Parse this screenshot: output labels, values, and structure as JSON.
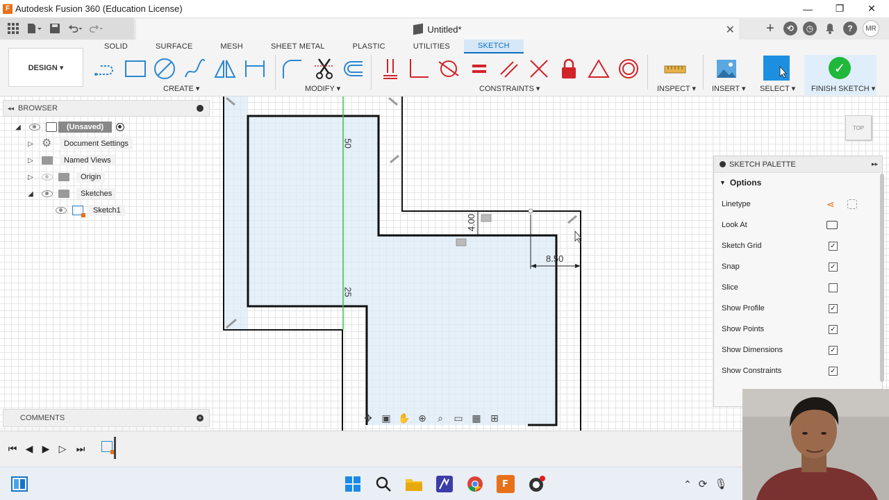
{
  "window": {
    "title": "Autodesk Fusion 360 (Education License)",
    "minimize": "—",
    "maximize": "❐",
    "close": "✕"
  },
  "document": {
    "tab_name": "Untitled*",
    "close": "✕",
    "new_tab": "+"
  },
  "user": {
    "initials": "MR"
  },
  "workspace": {
    "label": "DESIGN ▾"
  },
  "ribbon": {
    "tabs": [
      "SOLID",
      "SURFACE",
      "MESH",
      "SHEET METAL",
      "PLASTIC",
      "UTILITIES",
      "SKETCH"
    ],
    "active_tab": "SKETCH",
    "groups": {
      "create": "CREATE ▾",
      "modify": "MODIFY ▾",
      "constraints": "CONSTRAINTS ▾",
      "inspect": "INSPECT ▾",
      "insert": "INSERT ▾",
      "select": "SELECT ▾",
      "finish": "FINISH SKETCH ▾"
    }
  },
  "browser": {
    "title": "BROWSER",
    "root": "(Unsaved)",
    "items": [
      "Document Settings",
      "Named Views",
      "Origin",
      "Sketches"
    ],
    "sketch": "Sketch1"
  },
  "comments": {
    "title": "COMMENTS"
  },
  "view_cube": {
    "label": "TOP"
  },
  "dimensions": {
    "d1": "50",
    "d2": "25",
    "d3": "4.00",
    "d4": "8.50"
  },
  "palette": {
    "title": "SKETCH PALETTE",
    "section": "Options",
    "rows": [
      {
        "label": "Linetype",
        "type": "icon"
      },
      {
        "label": "Look At",
        "type": "icon"
      },
      {
        "label": "Sketch Grid",
        "checked": true
      },
      {
        "label": "Snap",
        "checked": true
      },
      {
        "label": "Slice",
        "checked": false
      },
      {
        "label": "Show Profile",
        "checked": true
      },
      {
        "label": "Show Points",
        "checked": true
      },
      {
        "label": "Show Dimensions",
        "checked": true
      },
      {
        "label": "Show Constraints",
        "checked": true
      }
    ]
  },
  "colors": {
    "accent": "#0b6fbf",
    "finish_green": "#1fb83a",
    "constraint_red": "#d2232a",
    "tool_blue": "#2a87d0",
    "profile_fill": "#dcebf7"
  }
}
